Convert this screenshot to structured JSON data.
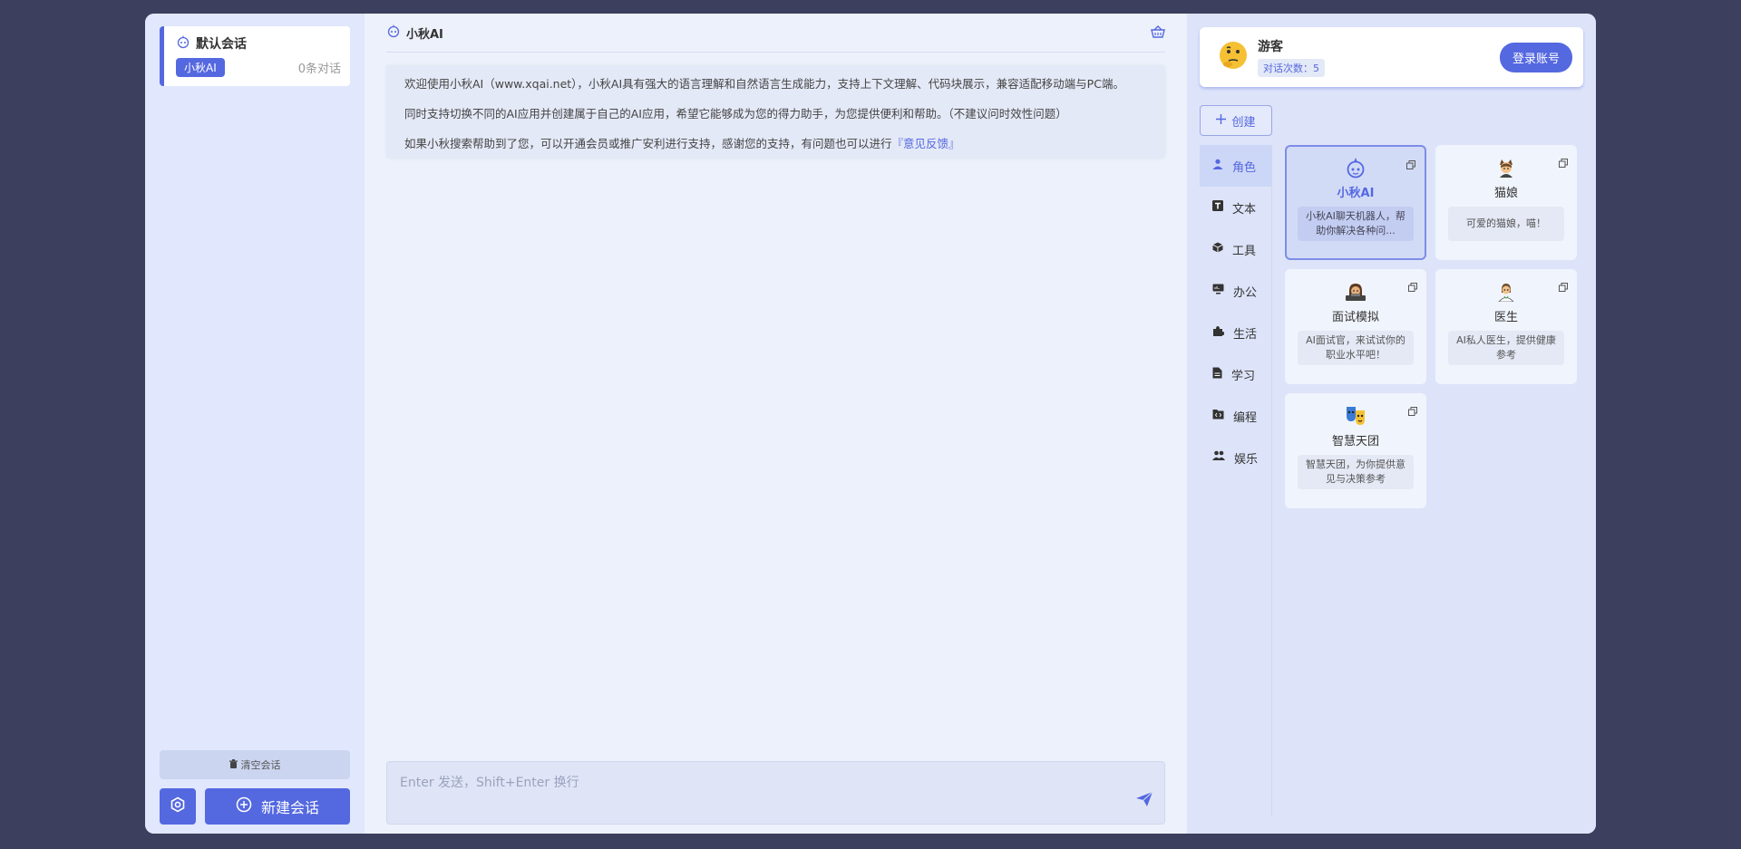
{
  "sidebar": {
    "conversation": {
      "title": "默认会话",
      "tag": "小秋AI",
      "count": "0条对话"
    },
    "clear_label": "清空会话",
    "new_label": "新建会话"
  },
  "chat": {
    "title": "小秋AI",
    "welcome": [
      "欢迎使用小秋AI（www.xqai.net），小秋AI具有强大的语言理解和自然语言生成能力，支持上下文理解、代码块展示，兼容适配移动端与PC端。",
      "同时支持切换不同的AI应用并创建属于自己的AI应用，希望它能够成为您的得力助手，为您提供便利和帮助。（不建议问时效性问题）"
    ],
    "welcome_last_prefix": "如果小秋搜索帮助到了您，可以开通会员或推广安利进行支持，感谢您的支持，有问题也可以进行",
    "feedback_link": "『意见反馈』",
    "input_placeholder": "Enter 发送，Shift+Enter 换行"
  },
  "user": {
    "name": "游客",
    "badge": "对话次数：5",
    "login_label": "登录账号"
  },
  "create_label": "创建",
  "categories": [
    {
      "label": "角色",
      "icon": "person-icon"
    },
    {
      "label": "文本",
      "icon": "text-icon"
    },
    {
      "label": "工具",
      "icon": "cube-icon"
    },
    {
      "label": "办公",
      "icon": "monitor-icon"
    },
    {
      "label": "生活",
      "icon": "puzzle-icon"
    },
    {
      "label": "学习",
      "icon": "document-icon"
    },
    {
      "label": "编程",
      "icon": "code-folder-icon"
    },
    {
      "label": "娱乐",
      "icon": "people-icon"
    }
  ],
  "cards": [
    {
      "name": "小秋AI",
      "desc": "小秋AI聊天机器人，帮助你解决各种问...",
      "icon": "robot-icon"
    },
    {
      "name": "猫娘",
      "desc": "可爱的猫娘，喵！",
      "icon": "cat-girl-icon"
    },
    {
      "name": "面试模拟",
      "desc": "AI面试官，来试试你的职业水平吧！",
      "icon": "interviewer-icon"
    },
    {
      "name": "医生",
      "desc": "AI私人医生，提供健康参考",
      "icon": "doctor-icon"
    },
    {
      "name": "智慧天团",
      "desc": "智慧天团，为你提供意见与决策参考",
      "icon": "masks-icon"
    }
  ],
  "colors": {
    "accent": "#5468e0",
    "background": "#3d3f5e"
  }
}
